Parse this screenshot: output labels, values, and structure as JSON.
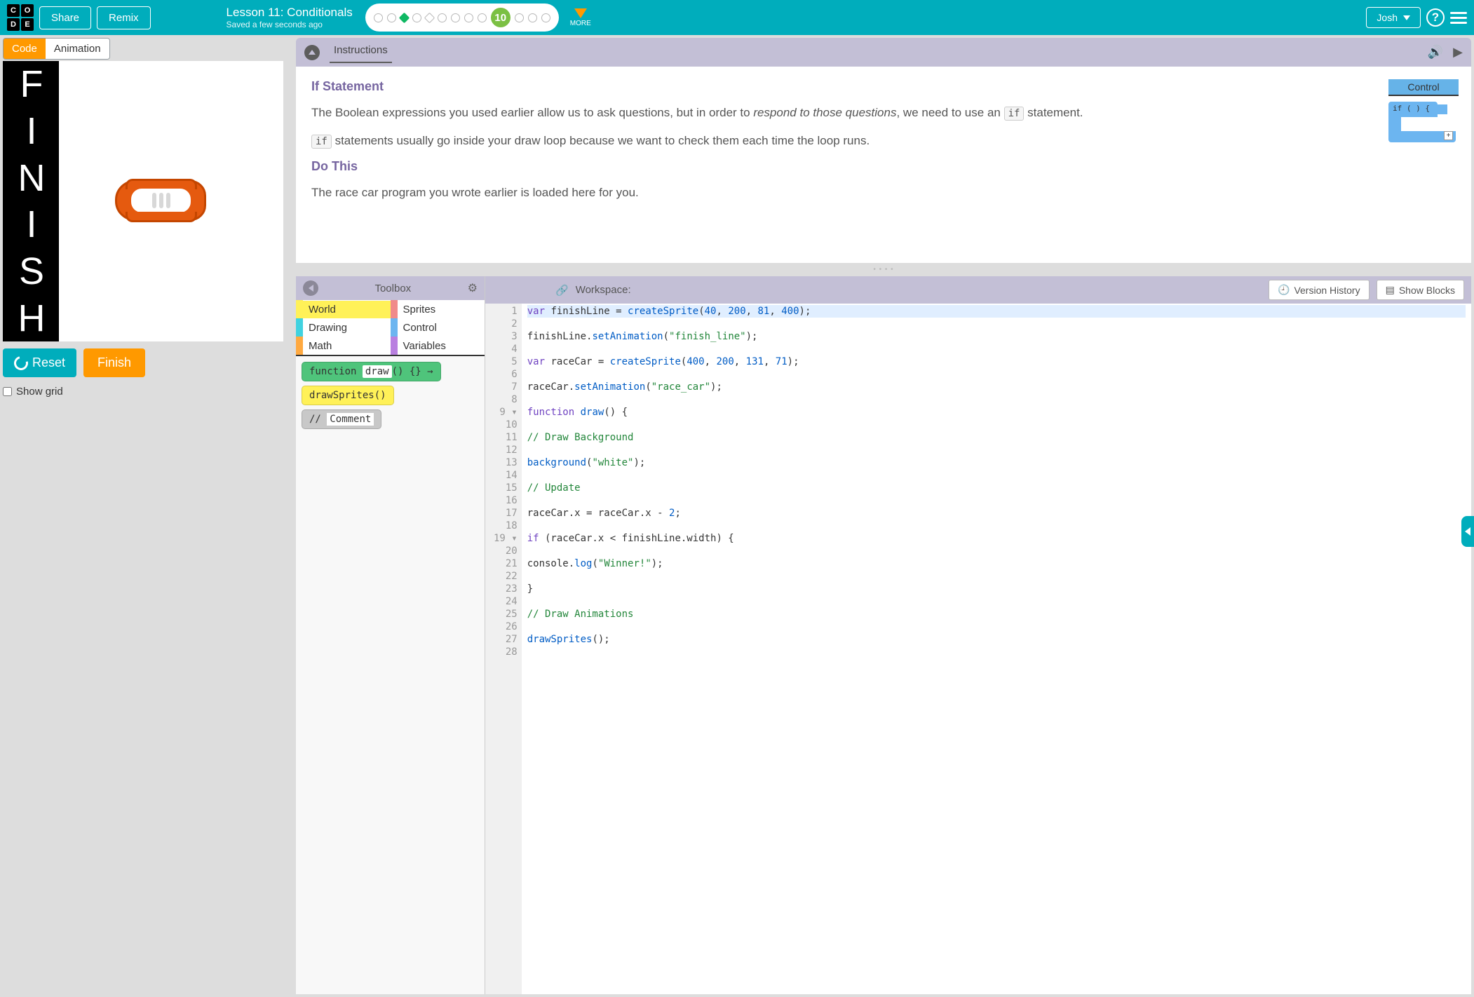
{
  "header": {
    "share": "Share",
    "remix": "Remix",
    "lesson_title": "Lesson 11: Conditionals",
    "saved_text": "Saved a few seconds ago",
    "current_step": "10",
    "more": "MORE",
    "user": "Josh"
  },
  "left": {
    "tab_code": "Code",
    "tab_animation": "Animation",
    "finish_letters": [
      "F",
      "I",
      "N",
      "I",
      "S",
      "H"
    ],
    "reset": "Reset",
    "finish": "Finish",
    "show_grid": "Show grid"
  },
  "instructions": {
    "tab_label": "Instructions",
    "title1": "If Statement",
    "para1a": "The Boolean expressions you used earlier allow us to ask questions, but in order to ",
    "para1b": "respond to those questions",
    "para1c": ", we need to use an ",
    "if_chip": "if",
    "para1d": " statement.",
    "para2a": " statements usually go inside your draw loop because we want to check them each time the loop runs.",
    "title2": "Do This",
    "para3": "The race car program you wrote earlier is loaded here for you.",
    "control_label": "Control",
    "if_block_text": "if (  ) {"
  },
  "toolbox": {
    "title": "Toolbox",
    "categories": [
      {
        "name": "World",
        "color": "#fff158",
        "active": true
      },
      {
        "name": "Sprites",
        "color": "#f08a8a"
      },
      {
        "name": "Drawing",
        "color": "#40d2e0"
      },
      {
        "name": "Control",
        "color": "#6cb5f0"
      },
      {
        "name": "Math",
        "color": "#ffa940"
      },
      {
        "name": "Variables",
        "color": "#b980e0"
      }
    ],
    "block_draw_a": "function ",
    "block_draw_b": "draw",
    "block_draw_c": "() {} →",
    "block_sprites": "drawSprites()",
    "block_comment_a": "// ",
    "block_comment_b": "Comment"
  },
  "workspace": {
    "label": "Workspace:",
    "version_history": "Version History",
    "show_blocks": "Show Blocks",
    "lines": [
      "var finishLine = createSprite(40, 200, 81, 400);",
      "",
      "finishLine.setAnimation(\"finish_line\");",
      "",
      "var raceCar = createSprite(400, 200, 131, 71);",
      "",
      "raceCar.setAnimation(\"race_car\");",
      "",
      "function draw() {",
      "",
      "// Draw Background",
      "",
      "background(\"white\");",
      "",
      "// Update",
      "",
      "raceCar.x = raceCar.x - 2;",
      "",
      "if (raceCar.x < finishLine.width) {",
      "",
      "console.log(\"Winner!\");",
      "",
      "}",
      "",
      "// Draw Animations",
      "",
      "drawSprites();",
      ""
    ]
  }
}
